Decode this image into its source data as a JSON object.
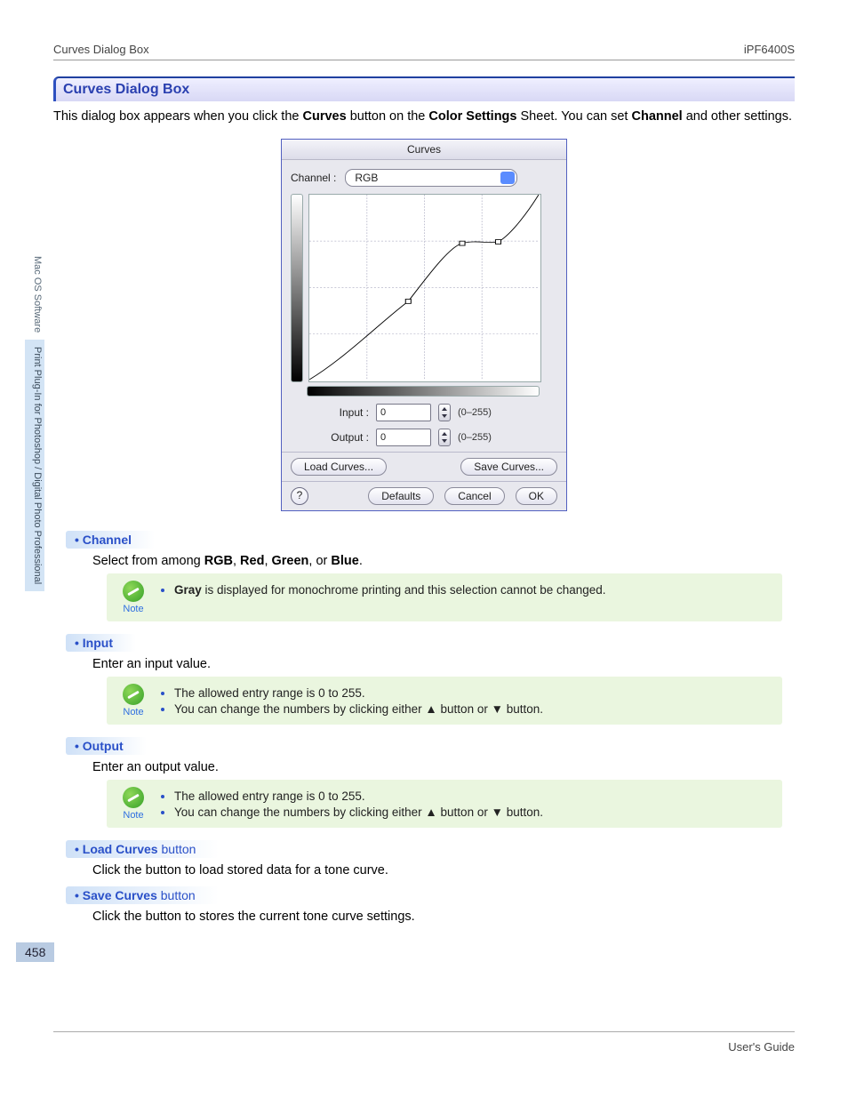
{
  "header": {
    "left": "Curves Dialog Box",
    "right": "iPF6400S"
  },
  "side_tabs": {
    "a": "Mac OS Software",
    "b": "Print Plug-In for Photoshop / Digital Photo Professional"
  },
  "section": {
    "title": "Curves Dialog Box"
  },
  "intro": {
    "p1a": "This dialog box appears when you click the ",
    "p1b": "Curves",
    "p1c": " button on the ",
    "p1d": "Color Settings",
    "p1e": " Sheet. You can set ",
    "p1f": "Channel",
    "p1g": " and other settings."
  },
  "dialog": {
    "title": "Curves",
    "channel_label": "Channel :",
    "channel_value": "RGB",
    "input_label": "Input :",
    "input_value": "0",
    "input_range": "(0–255)",
    "output_label": "Output :",
    "output_value": "0",
    "output_range": "(0–255)",
    "load_btn": "Load Curves...",
    "save_btn": "Save Curves...",
    "help_symbol": "?",
    "defaults_btn": "Defaults",
    "cancel_btn": "Cancel",
    "ok_btn": "OK"
  },
  "chart_data": {
    "type": "line",
    "title": "Curves",
    "xlabel": "Input",
    "ylabel": "Output",
    "xlim": [
      0,
      255
    ],
    "ylim": [
      0,
      255
    ],
    "grid_x": [
      0,
      64,
      128,
      192,
      255
    ],
    "grid_y": [
      0,
      64,
      128,
      192,
      255
    ],
    "series": [
      {
        "name": "RGB",
        "x_values": [
          0,
          64,
          110,
          170,
          210,
          255
        ],
        "y_values": [
          0,
          42,
          108,
          188,
          190,
          255
        ]
      }
    ],
    "control_points": [
      {
        "x": 110,
        "y": 108
      },
      {
        "x": 170,
        "y": 188
      },
      {
        "x": 210,
        "y": 190
      }
    ]
  },
  "items": {
    "channel": {
      "title": "Channel",
      "desc_a": "Select from among ",
      "desc_b1": "RGB",
      "desc_comma1": ", ",
      "desc_b2": "Red",
      "desc_comma2": ", ",
      "desc_b3": "Green",
      "desc_comma3": ", or ",
      "desc_b4": "Blue",
      "desc_period": ".",
      "note_label": "Note",
      "note_l1a": "",
      "note_l1b": "Gray",
      "note_l1c": " is displayed for monochrome printing and this selection cannot be changed."
    },
    "input": {
      "title": "Input",
      "desc": "Enter an input value.",
      "note_label": "Note",
      "note_l1": "The allowed entry range is 0 to 255.",
      "note_l2": "You can change the numbers by clicking either ▲ button or ▼ button."
    },
    "output": {
      "title": "Output",
      "desc": "Enter an output value.",
      "note_label": "Note",
      "note_l1": "The allowed entry range is 0 to 255.",
      "note_l2": "You can change the numbers by clicking either ▲ button or ▼ button."
    },
    "load": {
      "title_bold": "Load Curves",
      "title_thin": " button",
      "desc": "Click the button to load stored data for a tone curve."
    },
    "save": {
      "title_bold": "Save Curves",
      "title_thin": " button",
      "desc": "Click the button to stores the current tone curve settings."
    }
  },
  "footer": {
    "page_num": "458",
    "guide": "User's Guide"
  }
}
